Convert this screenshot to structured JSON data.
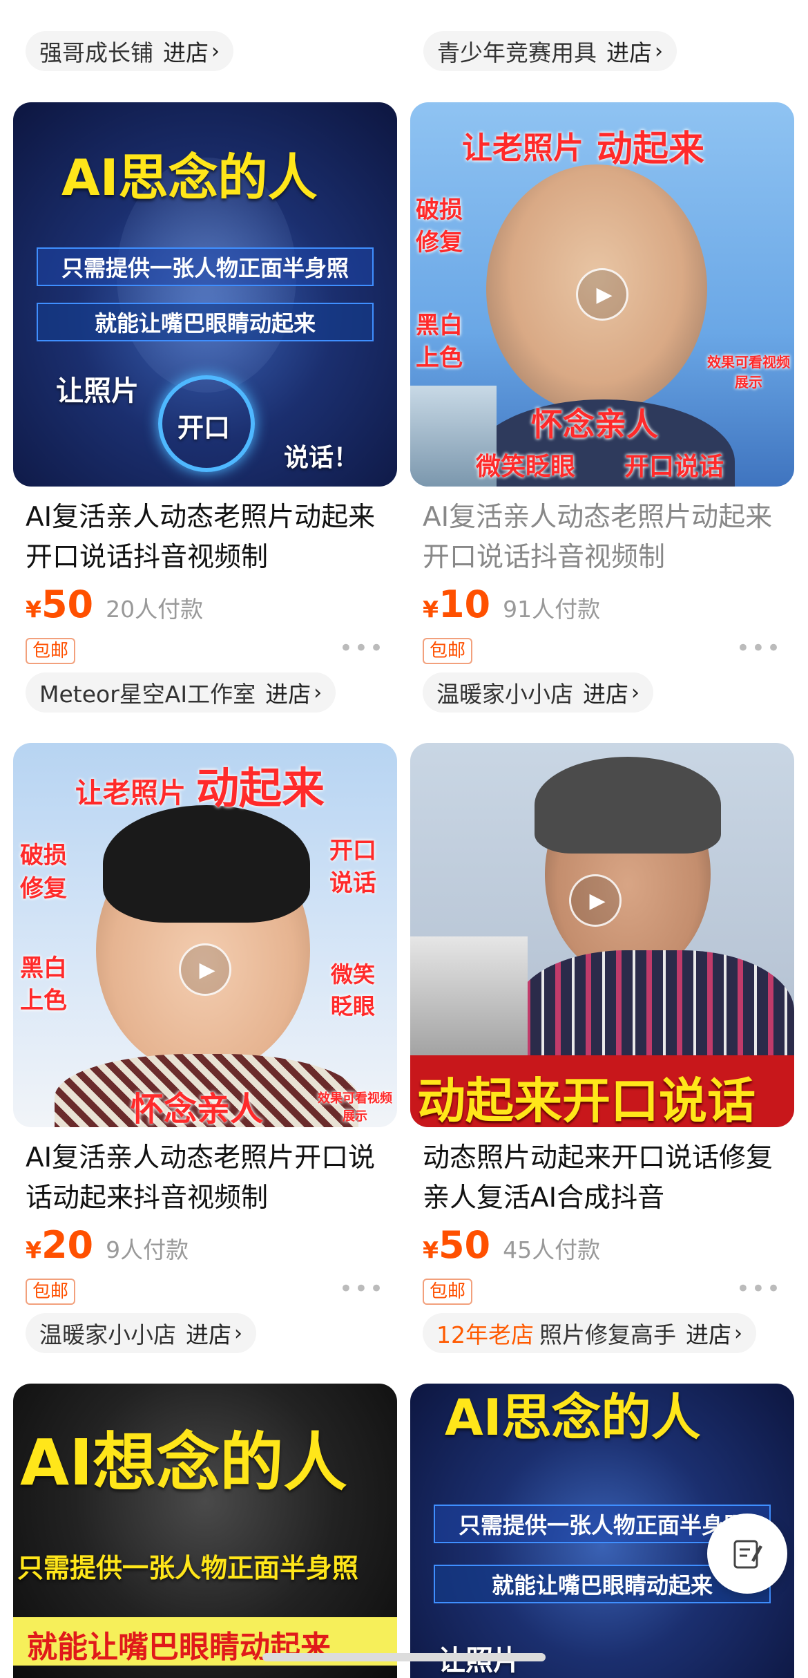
{
  "top_shops": [
    {
      "name": "强哥成长铺",
      "enter": "进店"
    },
    {
      "name": "青少年竞赛用具",
      "enter": "进店"
    }
  ],
  "products": [
    {
      "thumb": {
        "headline": "AI思念的人",
        "band1": "只需提供一张人物正面半身照",
        "band2": "就能让嘴巴眼睛动起来",
        "left_text": "让照片",
        "center_text": "开口",
        "right_text": "说话！"
      },
      "title": "AI复活亲人动态老照片动起来开口说话抖音视频制",
      "yen": "¥",
      "price": "50",
      "sold": "20人付款",
      "badge": "包邮",
      "more": "•••",
      "shop": {
        "tag": "",
        "name": "Meteor星空AI工作室",
        "enter": "进店"
      },
      "viewed": false
    },
    {
      "thumb": {
        "headline_a": "让老照片",
        "headline_b": "动起来",
        "left1": "破损",
        "left2": "修复",
        "left3": "黑白",
        "left4": "上色",
        "bottom1": "怀念亲人",
        "bottom2": "微笑眨眼",
        "bottom3": "开口说话",
        "note": "效果可看视频展示"
      },
      "title": "AI复活亲人动态老照片动起来开口说话抖音视频制",
      "yen": "¥",
      "price": "10",
      "sold": "91人付款",
      "badge": "包邮",
      "more": "•••",
      "shop": {
        "tag": "",
        "name": "温暖家小小店",
        "enter": "进店"
      },
      "viewed": true
    },
    {
      "thumb": {
        "headline_a": "让老照片",
        "headline_b": "动起来",
        "left1": "破损",
        "left2": "修复",
        "left3": "黑白",
        "left4": "上色",
        "right1": "开口",
        "right2": "说话",
        "right3": "微笑",
        "right4": "眨眼",
        "bottom": "怀念亲人",
        "note": "效果可看视频展示"
      },
      "title": "AI复活亲人动态老照片开口说话动起来抖音视频制",
      "yen": "¥",
      "price": "20",
      "sold": "9人付款",
      "badge": "包邮",
      "more": "•••",
      "shop": {
        "tag": "",
        "name": "温暖家小小店",
        "enter": "进店"
      },
      "viewed": false
    },
    {
      "thumb": {
        "banner": "动起来开口说话"
      },
      "title": "动态照片动起来开口说话修复亲人复活AI合成抖音",
      "yen": "¥",
      "price": "50",
      "sold": "45人付款",
      "badge": "包邮",
      "more": "•••",
      "shop": {
        "tag": "12年老店",
        "name": "照片修复高手",
        "enter": "进店"
      },
      "viewed": false
    },
    {
      "thumb": {
        "headline": "AI想念的人",
        "line1": "只需提供一张人物正面半身照",
        "line2": "就能让嘴巴眼睛动起来"
      }
    },
    {
      "thumb": {
        "headline": "AI思念的人",
        "band1": "只需提供一张人物正面半身照",
        "band2": "就能让嘴巴眼睛动起来",
        "left_text": "让照片"
      }
    }
  ],
  "fab": {
    "icon": "edit-note-icon"
  },
  "colors": {
    "price": "#ff5000",
    "tag": "#ff5a00",
    "chip_bg": "#f4f4f4"
  }
}
